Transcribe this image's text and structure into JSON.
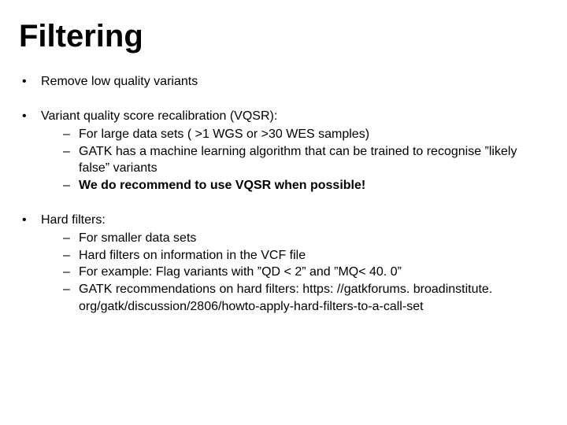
{
  "title": "Filtering",
  "bullets": {
    "b1": "Remove low quality variants",
    "b2": "Variant quality score recalibration (VQSR):",
    "b2_subs": {
      "s1": "For large data sets ( >1 WGS or >30 WES samples)",
      "s2": "GATK has a machine learning algorithm that can be trained to recognise ”likely false” variants",
      "s3": "We do recommend to use VQSR when possible!"
    },
    "b3": "Hard filters:",
    "b3_subs": {
      "s1": "For smaller data sets",
      "s2": "Hard filters on information in the VCF file",
      "s3": "For example: Flag variants with ”QD < 2” and ”MQ< 40. 0”",
      "s4": "GATK recommendations on hard filters: https: //gatkforums. broadinstitute. org/gatk/discussion/2806/howto-apply-hard-filters-to-a-call-set"
    }
  }
}
